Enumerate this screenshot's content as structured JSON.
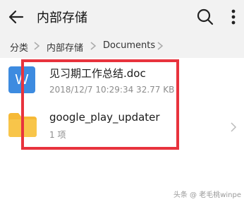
{
  "header": {
    "title": "内部存储",
    "back_icon": "back-arrow-icon",
    "search_icon": "search-icon",
    "more_icon": "more-vertical-icon"
  },
  "breadcrumb": {
    "items": [
      "分类",
      "内部存储",
      "Documents"
    ]
  },
  "files": [
    {
      "name": "见习期工作总结.doc",
      "meta": "2018/12/7 10:29:34 32.77 KB",
      "icon": "word-document-icon",
      "icon_letter": "W"
    },
    {
      "name": "google_play_updater",
      "meta": "1 项",
      "icon": "folder-icon"
    }
  ],
  "watermark": "头条 @ 老毛桃winpe",
  "colors": {
    "highlight": "#e8333d",
    "word_icon": "#3d8be0",
    "folder": "#f6b936",
    "topbar": "#f2f2f2"
  }
}
